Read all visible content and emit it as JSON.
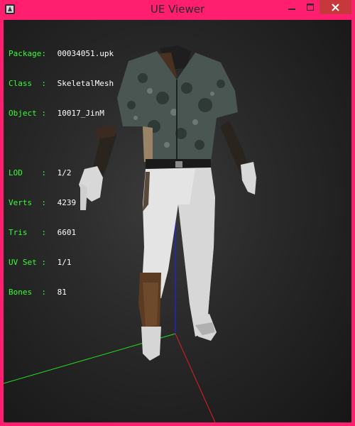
{
  "window": {
    "title": "UE Viewer",
    "controls": [
      "minimize-icon",
      "maximize-icon",
      "close-icon"
    ]
  },
  "info_panel": {
    "package_label": "Package:",
    "package_value": "00034051.upk",
    "class_label": "Class  :",
    "class_value": "SkeletalMesh",
    "object_label": "Object :",
    "object_value": "10017_JinM",
    "lod_label": "LOD    :",
    "lod_value": "1/2",
    "verts_label": "Verts  :",
    "verts_value": "4239",
    "tris_label": "Tris   :",
    "tris_value": "6601",
    "uvset_label": "UV Set :",
    "uvset_value": "1/1",
    "bones_label": "Bones  :",
    "bones_value": "81"
  },
  "colors": {
    "frame": "#ff1f6e",
    "label_green": "#35ff35",
    "axis_x": "#ff2020",
    "axis_y": "#20ff20",
    "axis_z": "#2020ff"
  }
}
